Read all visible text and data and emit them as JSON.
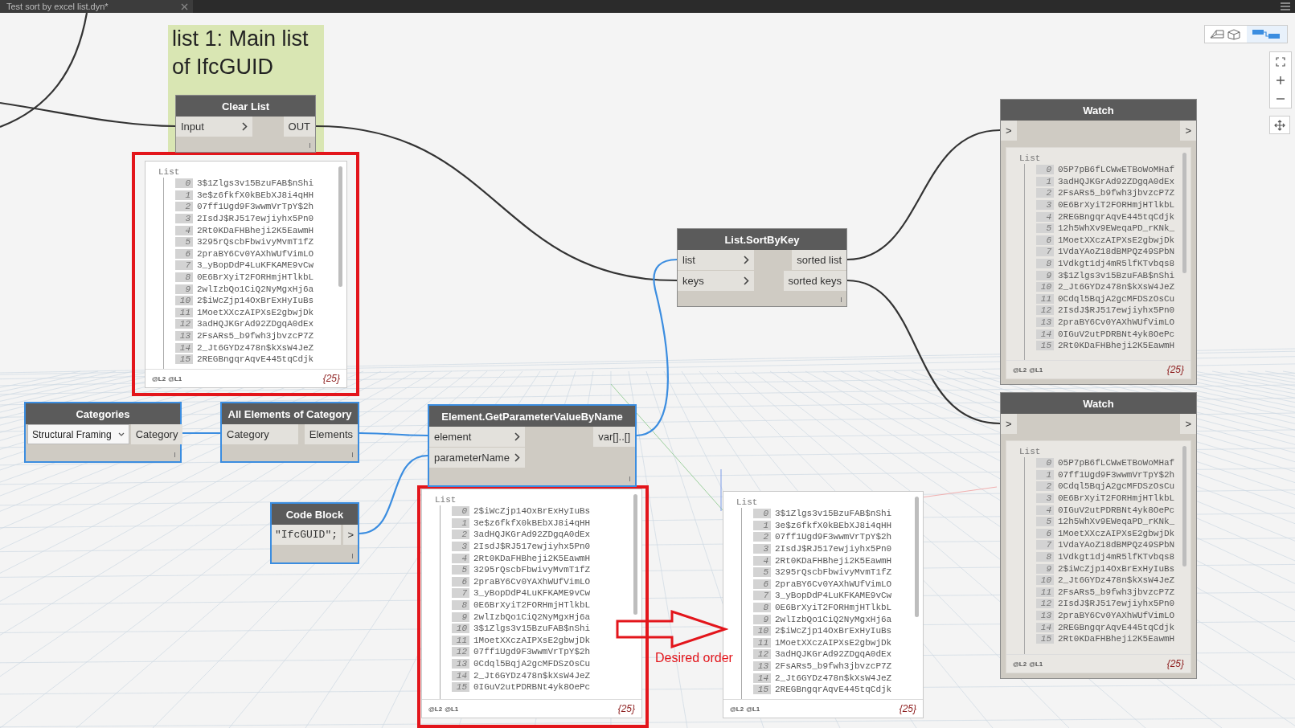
{
  "tab": {
    "title": "Test sort by excel list.dyn*"
  },
  "note": {
    "text": "list 1: Main list of IfcGUID"
  },
  "nodes": [
    {
      "kind": "function",
      "title": "Clear List",
      "selected": false,
      "inputs": [
        {
          "label": "Input",
          "chevron": true
        }
      ],
      "outputs": [
        "OUT"
      ],
      "list": {
        "header": "List",
        "levels": [
          "@L2",
          "@L1"
        ],
        "count": "{25}",
        "items": [
          {
            "index": "0",
            "value": "3$1Zlgs3v15BzuFAB$nShi"
          },
          {
            "index": "1",
            "value": "3e$z6fkfX0kBEbXJ8i4qHH"
          },
          {
            "index": "2",
            "value": "07ff1Ugd9F3wwmVrTpY$2h"
          },
          {
            "index": "3",
            "value": "2IsdJ$RJ517ewjiyhx5Pn0"
          },
          {
            "index": "4",
            "value": "2Rt0KDaFHBheji2K5EawmH"
          },
          {
            "index": "5",
            "value": "3295rQscbFbwivyMvmT1fZ"
          },
          {
            "index": "6",
            "value": "2praBY6Cv0YAXhWUfVimLO"
          },
          {
            "index": "7",
            "value": "3_yBopDdP4LuKFKAME9vCw"
          },
          {
            "index": "8",
            "value": "0E6BrXyiT2FORHmjHTlkbL"
          },
          {
            "index": "9",
            "value": "2wlIzbQo1CiQ2NyMgxHj6a"
          },
          {
            "index": "10",
            "value": "2$iWcZjp14OxBrExHyIuBs"
          },
          {
            "index": "11",
            "value": "1MoetXXczAIPXsE2gbwjDk"
          },
          {
            "index": "12",
            "value": "3adHQJKGrAd92ZDgqA0dEx"
          },
          {
            "index": "13",
            "value": "2FsARs5_b9fwh3jbvzcP7Z"
          },
          {
            "index": "14",
            "value": "2_Jt6GYDz478n$kXsW4JeZ"
          },
          {
            "index": "15",
            "value": "2REGBngqrAqvE445tqCdjk"
          }
        ]
      }
    },
    {
      "kind": "watch",
      "title": "Watch",
      "selected": false,
      "inputs": [
        {
          "label": ">",
          "chevron": false
        }
      ],
      "outputs": [
        ">"
      ],
      "list": {
        "header": "List",
        "levels": [
          "@L2",
          "@L1"
        ],
        "count": "{25}",
        "items": [
          {
            "index": "0",
            "value": "05P7pB6fLCWwETBoWoMHaf"
          },
          {
            "index": "1",
            "value": "3adHQJKGrAd92ZDgqA0dEx"
          },
          {
            "index": "2",
            "value": "2FsARs5_b9fwh3jbvzcP7Z"
          },
          {
            "index": "3",
            "value": "0E6BrXyiT2FORHmjHTlkbL"
          },
          {
            "index": "4",
            "value": "2REGBngqrAqvE445tqCdjk"
          },
          {
            "index": "5",
            "value": "12h5WhXv9EWeqaPD_rKNk_"
          },
          {
            "index": "6",
            "value": "1MoetXXczAIPXsE2gbwjDk"
          },
          {
            "index": "7",
            "value": "1VdaYAoZ18dBMPQz49SPbN"
          },
          {
            "index": "8",
            "value": "1Vdkgt1dj4mR5lfKTvbqs8"
          },
          {
            "index": "9",
            "value": "3$1Zlgs3v15BzuFAB$nShi"
          },
          {
            "index": "10",
            "value": "2_Jt6GYDz478n$kXsW4JeZ"
          },
          {
            "index": "11",
            "value": "0Cdql5BqjA2gcMFDSzOsCu"
          },
          {
            "index": "12",
            "value": "2IsdJ$RJ517ewjiyhx5Pn0"
          },
          {
            "index": "13",
            "value": "2praBY6Cv0YAXhWUfVimLO"
          },
          {
            "index": "14",
            "value": "0IGuV2utPDRBNt4yk8OePc"
          },
          {
            "index": "15",
            "value": "2Rt0KDaFHBheji2K5EawmH"
          }
        ]
      }
    },
    {
      "kind": "function",
      "title": "List.SortByKey",
      "selected": false,
      "inputs": [
        {
          "label": "list",
          "chevron": true
        },
        {
          "label": "keys",
          "chevron": true
        }
      ],
      "outputs": [
        "sorted list",
        "sorted keys"
      ]
    },
    {
      "kind": "watch",
      "title": "Watch",
      "selected": false,
      "inputs": [
        {
          "label": ">",
          "chevron": false
        }
      ],
      "outputs": [
        ">"
      ],
      "list": {
        "header": "List",
        "levels": [
          "@L2",
          "@L1"
        ],
        "count": "{25}",
        "items": [
          {
            "index": "0",
            "value": "05P7pB6fLCWwETBoWoMHaf"
          },
          {
            "index": "1",
            "value": "07ff1Ugd9F3wwmVrTpY$2h"
          },
          {
            "index": "2",
            "value": "0Cdql5BqjA2gcMFDSzOsCu"
          },
          {
            "index": "3",
            "value": "0E6BrXyiT2FORHmjHTlkbL"
          },
          {
            "index": "4",
            "value": "0IGuV2utPDRBNt4yk8OePc"
          },
          {
            "index": "5",
            "value": "12h5WhXv9EWeqaPD_rKNk_"
          },
          {
            "index": "6",
            "value": "1MoetXXczAIPXsE2gbwjDk"
          },
          {
            "index": "7",
            "value": "1VdaYAoZ18dBMPQz49SPbN"
          },
          {
            "index": "8",
            "value": "1Vdkgt1dj4mR5lfKTvbqs8"
          },
          {
            "index": "9",
            "value": "2$iWcZjp14OxBrExHyIuBs"
          },
          {
            "index": "10",
            "value": "2_Jt6GYDz478n$kXsW4JeZ"
          },
          {
            "index": "11",
            "value": "2FsARs5_b9fwh3jbvzcP7Z"
          },
          {
            "index": "12",
            "value": "2IsdJ$RJ517ewjiyhx5Pn0"
          },
          {
            "index": "13",
            "value": "2praBY6Cv0YAXhWUfVimLO"
          },
          {
            "index": "14",
            "value": "2REGBngqrAqvE445tqCdjk"
          },
          {
            "index": "15",
            "value": "2Rt0KDaFHBheji2K5EawmH"
          }
        ]
      }
    },
    {
      "kind": "dropdown",
      "title": "Categories",
      "selected": true,
      "value": "Structural Framing",
      "outputs": [
        "Category"
      ]
    },
    {
      "kind": "function",
      "title": "All Elements of Category",
      "selected": true,
      "inputs": [
        {
          "label": "Category",
          "chevron": false
        }
      ],
      "outputs": [
        "Elements"
      ]
    },
    {
      "kind": "function",
      "title": "Element.GetParameterValueByName",
      "selected": true,
      "inputs": [
        {
          "label": "element",
          "chevron": true
        },
        {
          "label": "parameterName",
          "chevron": true
        }
      ],
      "outputs": [
        "var[]..[]"
      ],
      "list": {
        "header": "List",
        "levels": [
          "@L2",
          "@L1"
        ],
        "count": "{25}",
        "items": [
          {
            "index": "0",
            "value": "2$iWcZjp14OxBrExHyIuBs"
          },
          {
            "index": "1",
            "value": "3e$z6fkfX0kBEbXJ8i4qHH"
          },
          {
            "index": "2",
            "value": "3adHQJKGrAd92ZDgqA0dEx"
          },
          {
            "index": "3",
            "value": "2IsdJ$RJ517ewjiyhx5Pn0"
          },
          {
            "index": "4",
            "value": "2Rt0KDaFHBheji2K5EawmH"
          },
          {
            "index": "5",
            "value": "3295rQscbFbwivyMvmT1fZ"
          },
          {
            "index": "6",
            "value": "2praBY6Cv0YAXhWUfVimLO"
          },
          {
            "index": "7",
            "value": "3_yBopDdP4LuKFKAME9vCw"
          },
          {
            "index": "8",
            "value": "0E6BrXyiT2FORHmjHTlkbL"
          },
          {
            "index": "9",
            "value": "2wlIzbQo1CiQ2NyMgxHj6a"
          },
          {
            "index": "10",
            "value": "3$1Zlgs3v15BzuFAB$nShi"
          },
          {
            "index": "11",
            "value": "1MoetXXczAIPXsE2gbwjDk"
          },
          {
            "index": "12",
            "value": "07ff1Ugd9F3wwmVrTpY$2h"
          },
          {
            "index": "13",
            "value": "0Cdql5BqjA2gcMFDSzOsCu"
          },
          {
            "index": "14",
            "value": "2_Jt6GYDz478n$kXsW4JeZ"
          },
          {
            "index": "15",
            "value": "0IGuV2utPDRBNt4yk8OePc"
          }
        ]
      }
    },
    {
      "kind": "preview",
      "list": {
        "header": "List",
        "levels": [
          "@L2",
          "@L1"
        ],
        "count": "{25}",
        "items": [
          {
            "index": "0",
            "value": "3$1Zlgs3v15BzuFAB$nShi"
          },
          {
            "index": "1",
            "value": "3e$z6fkfX0kBEbXJ8i4qHH"
          },
          {
            "index": "2",
            "value": "07ff1Ugd9F3wwmVrTpY$2h"
          },
          {
            "index": "3",
            "value": "2IsdJ$RJ517ewjiyhx5Pn0"
          },
          {
            "index": "4",
            "value": "2Rt0KDaFHBheji2K5EawmH"
          },
          {
            "index": "5",
            "value": "3295rQscbFbwivyMvmT1fZ"
          },
          {
            "index": "6",
            "value": "2praBY6Cv0YAXhWUfVimLO"
          },
          {
            "index": "7",
            "value": "3_yBopDdP4LuKFKAME9vCw"
          },
          {
            "index": "8",
            "value": "0E6BrXyiT2FORHmjHTlkbL"
          },
          {
            "index": "9",
            "value": "2wlIzbQo1CiQ2NyMgxHj6a"
          },
          {
            "index": "10",
            "value": "2$iWcZjp14OxBrExHyIuBs"
          },
          {
            "index": "11",
            "value": "1MoetXXczAIPXsE2gbwjDk"
          },
          {
            "index": "12",
            "value": "3adHQJKGrAd92ZDgqA0dEx"
          },
          {
            "index": "13",
            "value": "2FsARs5_b9fwh3jbvzcP7Z"
          },
          {
            "index": "14",
            "value": "2_Jt6GYDz478n$kXsW4JeZ"
          },
          {
            "index": "15",
            "value": "2REGBngqrAqvE445tqCdjk"
          }
        ]
      }
    },
    {
      "kind": "code",
      "title": "Code Block",
      "selected": true,
      "code": "\"IfcGUID\";",
      "outputs": [
        ">"
      ]
    }
  ],
  "annotation": {
    "text": "Desired order"
  }
}
